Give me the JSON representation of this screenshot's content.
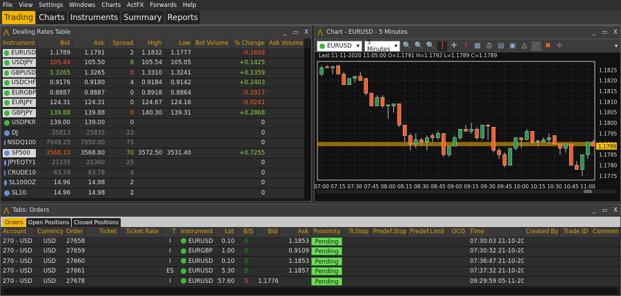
{
  "menu": [
    "File",
    "View",
    "Settings",
    "Windows",
    "Charts",
    "ActFX",
    "Forwards",
    "Help"
  ],
  "main_tabs": [
    {
      "label": "Trading",
      "active": true
    },
    {
      "label": "Charts"
    },
    {
      "label": "Instruments"
    },
    {
      "label": "Summary"
    },
    {
      "label": "Reports"
    }
  ],
  "dealing": {
    "title": "Dealing Rates Table",
    "columns": [
      "Instrument",
      "Bid",
      "Ask",
      "Spread",
      "High",
      "Low",
      "Bid Volume",
      "% Change",
      "Ask Volume"
    ],
    "rows": [
      {
        "instrument": "EURUSD",
        "dot": "#3cb83c",
        "bid": "1.1789",
        "ask": "1.1791",
        "spread": "2",
        "high": "1.1832",
        "low": "1.1777",
        "change": "-0.1609",
        "cc": "red",
        "hl": true
      },
      {
        "instrument": "USDJPY",
        "dot": "#3cb83c",
        "bid": "105.44",
        "bc": "red",
        "ask": "105.50",
        "spread": "6",
        "sc": "grn",
        "high": "105.54",
        "low": "105.05",
        "change": "+0.1425",
        "cc": "grn",
        "hl": true
      },
      {
        "instrument": "GBPUSD",
        "dot": "#3cb83c",
        "bid": "1.3265",
        "bc": "grn",
        "ask": "1.3265",
        "spread": "0",
        "sc": "red",
        "high": "1.3310",
        "low": "1.3241",
        "change": "+0.1359",
        "cc": "grn",
        "hl": true
      },
      {
        "instrument": "USDCHF",
        "dot": "#3cb83c",
        "bid": "0.9176",
        "ask": "0.9180",
        "spread": "4",
        "high": "0.9184",
        "low": "0.9142",
        "change": "+0.2403",
        "cc": "grn",
        "hl": true
      },
      {
        "instrument": "EURGBP",
        "dot": "#3cb83c",
        "bid": "0.8887",
        "ask": "0.8887",
        "spread": "0",
        "high": "0.8918",
        "low": "0.8864",
        "change": "-0.2917",
        "cc": "red",
        "hl": true
      },
      {
        "instrument": "EURJPY",
        "dot": "#3cb83c",
        "bid": "124.31",
        "ask": "124.31",
        "spread": "0",
        "high": "124.67",
        "low": "124.16",
        "change": "-0.0241",
        "cc": "red",
        "hl": true
      },
      {
        "instrument": "GBPJPY",
        "dot": "#3cb83c",
        "bid": "139.88",
        "bc": "grn",
        "ask": "139.88",
        "spread": "0",
        "sc": "red",
        "high": "140.30",
        "low": "139.31",
        "change": "+0.2868",
        "cc": "grn",
        "hl": true
      },
      {
        "instrument": "USDPKR",
        "dot": "#3cb83c",
        "bid": "139.00",
        "ask": "139.00",
        "spread": "0",
        "high": "",
        "low": "",
        "change": "0"
      },
      {
        "instrument": "DJ",
        "dot": "#6a8fd8",
        "bid": "25813",
        "bc": "dim",
        "ask": "25835",
        "ac": "dim",
        "spread": "22",
        "sc": "dim",
        "high": "",
        "low": "",
        "change": "0"
      },
      {
        "instrument": "NSDQ100",
        "dot": "#6a8fd8",
        "bid": "7049.25",
        "bc": "dim",
        "ask": "7050.00",
        "ac": "dim",
        "spread": "75",
        "sc": "dim",
        "high": "",
        "low": "",
        "change": "0"
      },
      {
        "instrument": "SP500",
        "dot": "#6a8fd8",
        "bid": "3568.10",
        "bc": "red",
        "ask": "3568.80",
        "spread": "70",
        "sc": "grn",
        "high": "3572.50",
        "low": "3531.40",
        "change": "+0.7255",
        "cc": "grn",
        "hl": true
      },
      {
        "instrument": "JPYEQTY1",
        "dot": "#6a8fd8",
        "bid": "21335",
        "bc": "dim",
        "ask": "21360",
        "ac": "dim",
        "spread": "25",
        "sc": "dim",
        "high": "",
        "low": "",
        "change": "0"
      },
      {
        "instrument": "CRUDE10",
        "dot": "#6a8fd8",
        "bid": "63.74",
        "bc": "dim",
        "ask": "63.78",
        "ac": "dim",
        "spread": "4",
        "sc": "dim",
        "high": "",
        "low": "",
        "change": "0"
      },
      {
        "instrument": "SL100OZ",
        "dot": "#6a8fd8",
        "bid": "14.96",
        "ask": "14.98",
        "spread": "2",
        "high": "",
        "low": "",
        "change": "0"
      },
      {
        "instrument": "SL10",
        "dot": "#6a8fd8",
        "bid": "14.96",
        "ask": "14.98",
        "spread": "2",
        "high": "",
        "low": "",
        "change": "0"
      }
    ]
  },
  "chart": {
    "title": "Chart - EURUSD - 5 Minutes",
    "symbol": "EURUSD",
    "interval": "5 Minutes",
    "info": "Last:11-11-2020 11:05:00 O=1.1791 H=1.1792 L=1.1789 C=1.1789",
    "last_price": "1.1789"
  },
  "chart_data": {
    "type": "candlestick",
    "symbol": "EURUSD",
    "interval": "5 Minutes",
    "ylim": [
      1.1773,
      1.1829
    ],
    "yticks": [
      "1.1825",
      "1.1820",
      "1.1815",
      "1.1810",
      "1.1805",
      "1.1800",
      "1.1795",
      "1.1790",
      "1.1785",
      "1.1780",
      "1.1775"
    ],
    "xticks": [
      "07:00",
      "07:15",
      "07:30",
      "07:45",
      "08:00",
      "08:15",
      "08:30",
      "08:45",
      "09:00",
      "09:15",
      "09:30",
      "09:45",
      "10:00",
      "10:15",
      "10:30",
      "10:45",
      "11:00"
    ],
    "up_color": "#1f9a4a",
    "down_color": "#ff5a1f",
    "band_color": "#b8860b",
    "ohlc": [
      [
        1.1823,
        1.1827,
        1.1822,
        1.1826
      ],
      [
        1.18265,
        1.1827,
        1.1826,
        1.1826
      ],
      [
        1.1826,
        1.1827,
        1.1823,
        1.18265
      ],
      [
        1.1827,
        1.1827,
        1.1823,
        1.1823
      ],
      [
        1.1823,
        1.1824,
        1.1818,
        1.1818
      ],
      [
        1.1818,
        1.1821,
        1.1818,
        1.1821
      ],
      [
        1.1821,
        1.1822,
        1.1819,
        1.1822
      ],
      [
        1.1822,
        1.1824,
        1.182,
        1.182
      ],
      [
        1.1821,
        1.1821,
        1.1813,
        1.1814
      ],
      [
        1.1814,
        1.1814,
        1.1808,
        1.1808
      ],
      [
        1.1808,
        1.1813,
        1.1808,
        1.1812
      ],
      [
        1.1812,
        1.1813,
        1.1807,
        1.1808
      ],
      [
        1.1808,
        1.18085,
        1.1802,
        1.18085
      ],
      [
        1.1808,
        1.1809,
        1.1805,
        1.1809
      ],
      [
        1.1809,
        1.1809,
        1.1798,
        1.1799
      ],
      [
        1.1799,
        1.1799,
        1.1791,
        1.1794
      ],
      [
        1.1794,
        1.1795,
        1.1787,
        1.179
      ],
      [
        1.179,
        1.1795,
        1.1788,
        1.1792
      ],
      [
        1.1792,
        1.1793,
        1.1789,
        1.1791
      ],
      [
        1.1791,
        1.1794,
        1.1787,
        1.1793
      ],
      [
        1.1794,
        1.1795,
        1.1791,
        1.1793
      ],
      [
        1.1793,
        1.1796,
        1.1792,
        1.1795
      ],
      [
        1.1795,
        1.1795,
        1.1784,
        1.1785
      ],
      [
        1.1785,
        1.1789,
        1.1784,
        1.1789
      ],
      [
        1.1789,
        1.1794,
        1.1789,
        1.1793
      ],
      [
        1.1793,
        1.1797,
        1.1792,
        1.1797
      ],
      [
        1.1797,
        1.1799,
        1.1796,
        1.1796
      ],
      [
        1.1796,
        1.18,
        1.1795,
        1.1797
      ],
      [
        1.1797,
        1.1798,
        1.1792,
        1.1793
      ],
      [
        1.1793,
        1.1799,
        1.1792,
        1.1799
      ],
      [
        1.1799,
        1.1799,
        1.1792,
        1.17985
      ],
      [
        1.1798,
        1.1798,
        1.1786,
        1.1787
      ],
      [
        1.1787,
        1.1788,
        1.1783,
        1.1785
      ],
      [
        1.1785,
        1.1786,
        1.1779,
        1.178
      ],
      [
        1.178,
        1.1788,
        1.178,
        1.1788
      ],
      [
        1.1788,
        1.1793,
        1.1787,
        1.1793
      ],
      [
        1.1793,
        1.1793,
        1.1788,
        1.1792
      ],
      [
        1.1792,
        1.1797,
        1.1792,
        1.1796
      ],
      [
        1.1796,
        1.1796,
        1.179,
        1.1791
      ],
      [
        1.1791,
        1.1792,
        1.1789,
        1.17915
      ],
      [
        1.1791,
        1.1793,
        1.1791,
        1.1792
      ],
      [
        1.1792,
        1.1795,
        1.179,
        1.1793
      ],
      [
        1.1794,
        1.1794,
        1.179,
        1.179
      ],
      [
        1.179,
        1.179,
        1.1785,
        1.1788
      ],
      [
        1.1788,
        1.179,
        1.1786,
        1.179
      ],
      [
        1.179,
        1.179,
        1.178,
        1.178
      ],
      [
        1.178,
        1.1782,
        1.1778,
        1.1778
      ],
      [
        1.1778,
        1.1785,
        1.1775,
        1.1785
      ],
      [
        1.1785,
        1.1791,
        1.1783,
        1.1791
      ],
      [
        1.1791,
        1.1792,
        1.1789,
        1.1789
      ]
    ]
  },
  "orders": {
    "title": "Tabs: Orders",
    "tabs": [
      {
        "label": "Orders",
        "active": true
      },
      {
        "label": "Open Positions"
      },
      {
        "label": "Closed Positions"
      }
    ],
    "columns": [
      "Account",
      "Currency",
      "Order",
      "Ticket",
      "Ticket Rate",
      "T",
      "Instrument",
      "Lot",
      "B/S",
      "Bid",
      "Ask",
      "Proximity",
      "Tr.Stop",
      "Predef.Stop",
      "Predef.Limit",
      "OCO",
      "Time",
      "Created By",
      "Trade ID",
      "Comment"
    ],
    "rows": [
      {
        "account": "270 - USD",
        "currency": "USD",
        "order": "27658",
        "t": "I",
        "instrument": "EURUSD",
        "lot": "0.10",
        "bs": "B",
        "bid": "",
        "ask": "1.1853",
        "proximity": "Pending",
        "time": "07:30:03 21-10-20..."
      },
      {
        "account": "270 - USD",
        "currency": "USD",
        "order": "27659",
        "t": "I",
        "instrument": "EURGBP",
        "lot": "1.00",
        "bs": "B",
        "bid": "",
        "ask": "0.9109",
        "proximity": "Pending",
        "time": "07:30:32 21-10-20..."
      },
      {
        "account": "270 - USD",
        "currency": "USD",
        "order": "27660",
        "t": "I",
        "instrument": "EURUSD",
        "lot": "0.10",
        "bs": "B",
        "bid": "",
        "ask": "1.1853",
        "proximity": "Pending",
        "time": "07:36:47 21-10-20..."
      },
      {
        "account": "270 - USD",
        "currency": "USD",
        "order": "27661",
        "t": "ES",
        "instrument": "EURUSD",
        "lot": "5.30",
        "bs": "B",
        "bid": "",
        "ask": "1.1857",
        "proximity": "Pending",
        "time": "07:37:32 21-10-20..."
      },
      {
        "account": "270 - USD",
        "currency": "USD",
        "order": "27678",
        "t": "I",
        "instrument": "EURUSD",
        "lot": "57.60",
        "bs": "S",
        "bid": "1.1776",
        "ask": "",
        "proximity": "Pending",
        "time": "09:29:59 05-11-20..."
      }
    ]
  }
}
